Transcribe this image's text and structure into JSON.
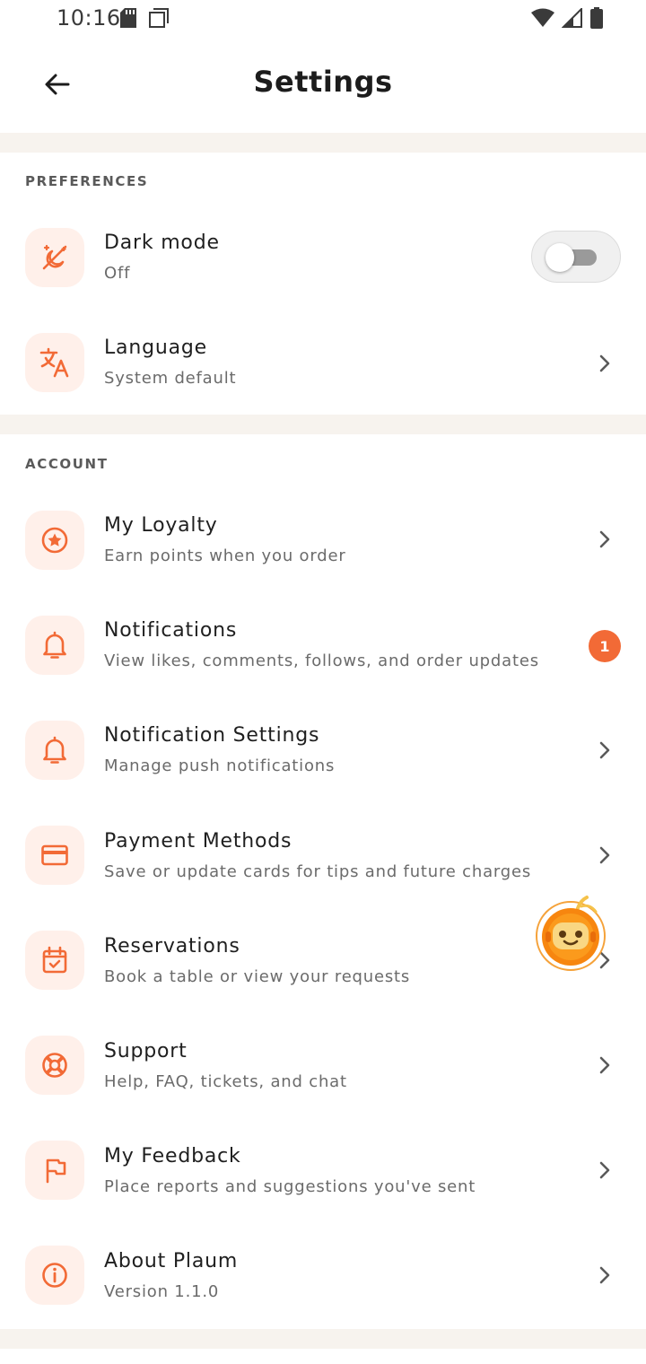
{
  "status_bar": {
    "time": "10:16",
    "icons": [
      "sd-card-icon",
      "screenshot-icon",
      "wifi-icon",
      "cell-signal-icon",
      "battery-icon"
    ]
  },
  "header": {
    "title": "Settings",
    "back_icon": "arrow-left-icon"
  },
  "colors": {
    "accent": "#f26a36",
    "icon_bg": "#fff0ea",
    "divider": "#f7f3ee"
  },
  "preferences": {
    "header": "PREFERENCES",
    "items": [
      {
        "title": "Dark mode",
        "subtitle": "Off",
        "icon": "dark-mode-icon",
        "control": "toggle",
        "toggle_on": false
      },
      {
        "title": "Language",
        "subtitle": "System default",
        "icon": "translate-icon",
        "control": "chevron"
      }
    ]
  },
  "account": {
    "header": "ACCOUNT",
    "items": [
      {
        "title": "My Loyalty",
        "subtitle": "Earn points when you order",
        "icon": "star-circle-icon",
        "control": "chevron"
      },
      {
        "title": "Notifications",
        "subtitle": "View likes, comments, follows, and order updates",
        "icon": "bell-icon",
        "control": "badge",
        "badge": "1"
      },
      {
        "title": "Notification Settings",
        "subtitle": "Manage push notifications",
        "icon": "bell-icon",
        "control": "chevron"
      },
      {
        "title": "Payment Methods",
        "subtitle": "Save or update cards for tips and future charges",
        "icon": "credit-card-icon",
        "control": "chevron"
      },
      {
        "title": "Reservations",
        "subtitle": "Book a table or view your requests",
        "icon": "calendar-check-icon",
        "control": "chevron"
      },
      {
        "title": "Support",
        "subtitle": "Help, FAQ, tickets, and chat",
        "icon": "lifebuoy-icon",
        "control": "chevron"
      },
      {
        "title": "My Feedback",
        "subtitle": "Place reports and suggestions you've sent",
        "icon": "flag-icon",
        "control": "chevron"
      },
      {
        "title": "About Plaum",
        "subtitle": "Version 1.1.0",
        "icon": "info-icon",
        "control": "chevron"
      }
    ]
  },
  "floating_assistant": {
    "icon": "robot-mascot-icon"
  }
}
